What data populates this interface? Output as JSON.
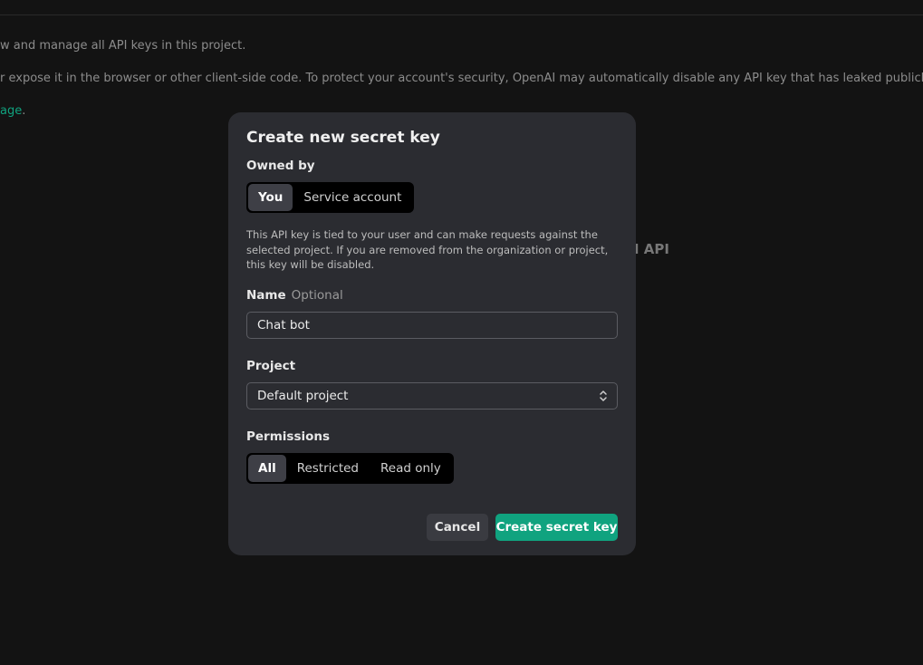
{
  "background": {
    "line_1": "w and manage all API keys in this project.",
    "line_2": "r expose it in the browser or other client-side code. To protect your account's security, OpenAI may automatically disable any API key that has leaked publicly.",
    "line_3_link": "age",
    "line_3_tail": ".",
    "heading_fragment": "I API"
  },
  "modal": {
    "title": "Create new secret key",
    "owned_by": {
      "label": "Owned by",
      "options": [
        "You",
        "Service account"
      ],
      "selected": "You"
    },
    "help_text": "This API key is tied to your user and can make requests against the selected project. If you are removed from the organization or project, this key will be disabled.",
    "name": {
      "label": "Name",
      "optional": "Optional",
      "value": "Chat bot"
    },
    "project": {
      "label": "Project",
      "value": "Default project"
    },
    "permissions": {
      "label": "Permissions",
      "options": [
        "All",
        "Restricted",
        "Read only"
      ],
      "selected": "All"
    },
    "cancel_label": "Cancel",
    "create_label": "Create secret key"
  },
  "colors": {
    "accent": "#10a37f",
    "modal_bg": "#2b2c31",
    "page_bg": "#131313"
  }
}
